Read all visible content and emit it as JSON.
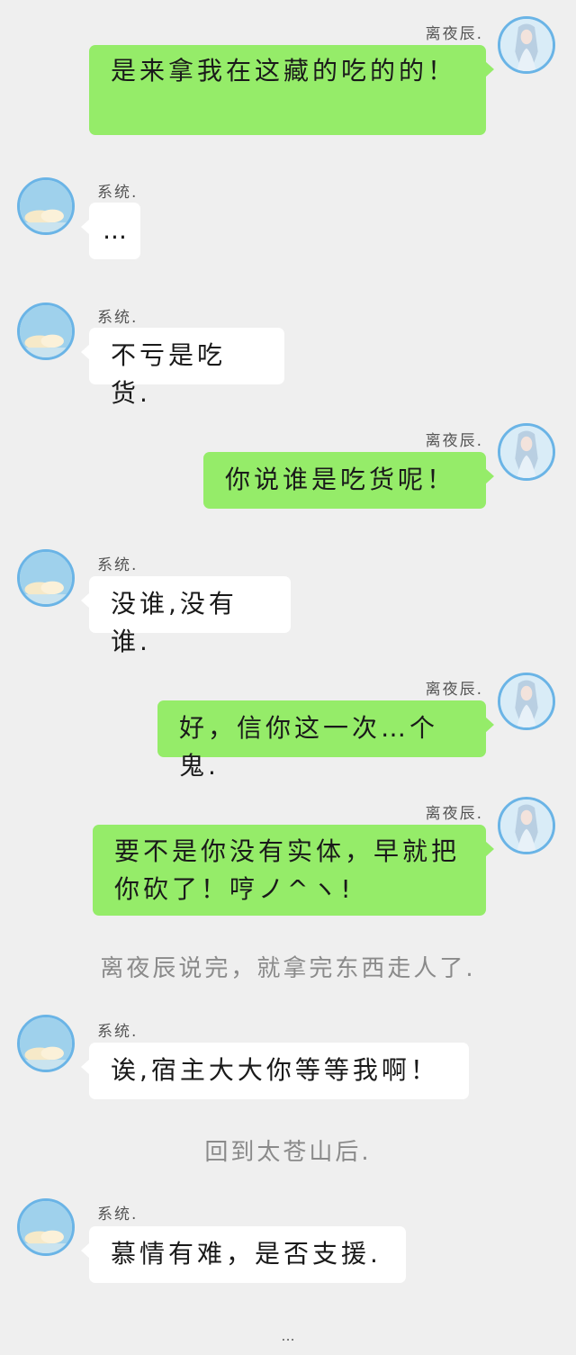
{
  "characters": {
    "hero": {
      "name": "离夜辰",
      "avatar_icon": "long-haired-character-avatar-icon"
    },
    "system": {
      "name": "系统",
      "avatar_icon": "cloud-sky-avatar-icon"
    }
  },
  "colors": {
    "background": "#efefef",
    "green_bubble": "#95ec69",
    "white_bubble": "#ffffff",
    "avatar_border": "#6ab4e6"
  },
  "messages": [
    {
      "speaker": "离夜辰.",
      "text": "是来拿我在这藏的吃的的！"
    },
    {
      "speaker": "系统.",
      "text": "..."
    },
    {
      "speaker": "系统.",
      "text": "不亏是吃货."
    },
    {
      "speaker": "离夜辰.",
      "text": "你说谁是吃货呢！"
    },
    {
      "speaker": "系统.",
      "text": "没谁,没有谁."
    },
    {
      "speaker": "离夜辰.",
      "text": "好，信你这一次…个鬼."
    },
    {
      "speaker": "离夜辰.",
      "text": "要不是你没有实体，早就把你砍了！哼ノ^ヽ!"
    },
    {
      "narration": "离夜辰说完，就拿完东西走人了."
    },
    {
      "speaker": "系统.",
      "text": "诶,宿主大大你等等我啊！"
    },
    {
      "narration": "回到太苍山后."
    },
    {
      "speaker": "系统.",
      "text": "慕情有难，是否支援."
    },
    {
      "ending": "..."
    }
  ]
}
